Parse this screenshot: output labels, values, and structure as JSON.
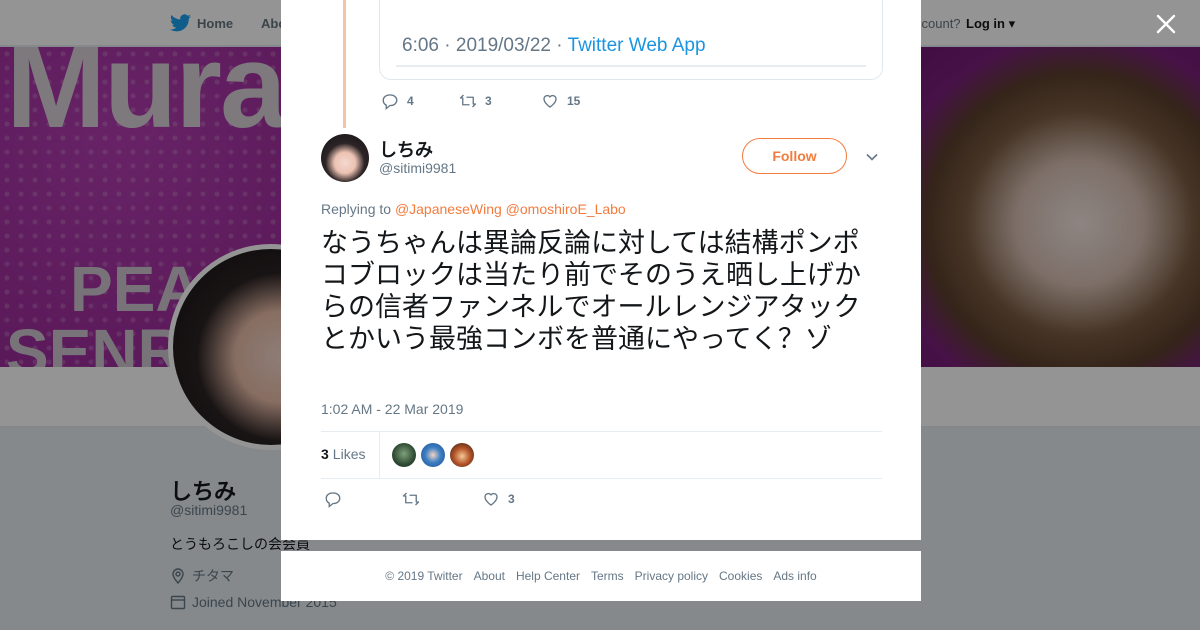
{
  "nav": {
    "home_label": "Home",
    "about_label": "Abo",
    "account_prompt": "ccount?",
    "login_label": "Log in"
  },
  "banner": {
    "text_top": "Mura",
    "text_mid": "PEAC",
    "text_bottom": "SENRA"
  },
  "profile": {
    "name": "しちみ",
    "handle": "@sitimi9981",
    "bio": "とうもろこしの会会員",
    "location": "チタマ",
    "joined": "Joined November 2015"
  },
  "quoted": {
    "time": "6:06",
    "date": "2019/03/22",
    "via": "Twitter Web App",
    "sep": "·"
  },
  "prev_tweet_actions": {
    "replies": "4",
    "retweets": "3",
    "likes": "15"
  },
  "tweet": {
    "name": "しちみ",
    "handle": "@sitimi9981",
    "follow_label": "Follow",
    "replying_prefix": "Replying to",
    "reply_to_1": "@JapaneseWing",
    "reply_to_2": "@omoshiroE_Labo",
    "text": "なうちゃんは異論反論に対しては結構ポンポコブロックは当たり前でそのうえ晒し上げからの信者ファンネルでオールレンジアタックとかいう最強コンボを普通にやってく？ゾ",
    "timestamp": "1:02 AM - 22 Mar 2019",
    "likes_count": "3",
    "likes_label": "Likes",
    "action_likes": "3"
  },
  "footer": {
    "copyright": "© 2019 Twitter",
    "links": [
      "About",
      "Help Center",
      "Terms",
      "Privacy policy",
      "Cookies",
      "Ads info"
    ]
  },
  "colors": {
    "accent": "#f47b3e",
    "link_blue": "#1b95e0",
    "thread_line": "#f5c3a8",
    "banner_purple": "#8a1f8a"
  }
}
